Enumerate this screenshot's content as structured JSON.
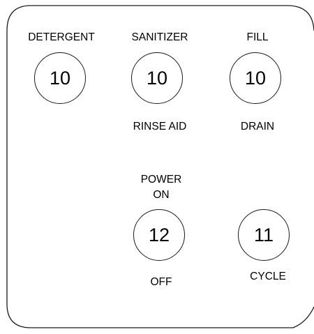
{
  "panel": {
    "detergent": {
      "top_label": "DETERGENT",
      "value": "10"
    },
    "sanitizer": {
      "top_label": "SANITIZER",
      "value": "10",
      "bottom_label": "RINSE AID"
    },
    "fill": {
      "top_label": "FILL",
      "value": "10",
      "bottom_label": "DRAIN"
    },
    "power": {
      "top_label_line1": "POWER",
      "top_label_line2": "ON",
      "value": "12",
      "bottom_label": "OFF"
    },
    "cycle": {
      "value": "11",
      "bottom_label": "CYCLE"
    }
  },
  "colors": {
    "stroke": "#1a1a1a",
    "background": "#ffffff",
    "text": "#000000"
  }
}
